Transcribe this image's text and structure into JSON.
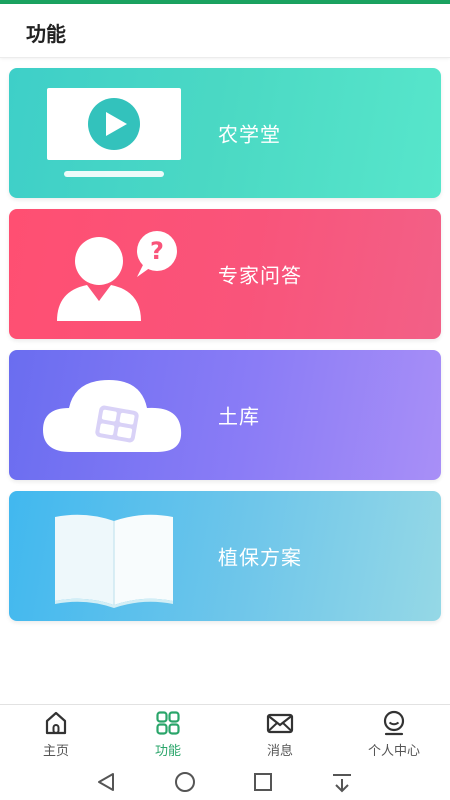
{
  "header": {
    "title": "功能"
  },
  "cards": [
    {
      "label": "农学堂",
      "icon": "video-play-icon"
    },
    {
      "label": "专家问答",
      "icon": "expert-question-icon"
    },
    {
      "label": "土库",
      "icon": "cloud-grid-icon"
    },
    {
      "label": "植保方案",
      "icon": "open-book-icon"
    }
  ],
  "bottom_nav": {
    "items": [
      {
        "label": "主页",
        "icon": "home-icon"
      },
      {
        "label": "功能",
        "icon": "grid-icon",
        "active": true
      },
      {
        "label": "消息",
        "icon": "mail-icon"
      },
      {
        "label": "个人中心",
        "icon": "profile-icon"
      }
    ]
  },
  "colors": {
    "accent": "#1aa260",
    "active_tab": "#2aa56a",
    "card_teal": "#4bd9c4",
    "card_red": "#f9547a",
    "card_purple": "#8a7cf6",
    "card_blue": "#6fc6ea"
  },
  "system_nav": [
    "back-icon",
    "home-circle-icon",
    "recents-square-icon",
    "notification-down-icon"
  ]
}
